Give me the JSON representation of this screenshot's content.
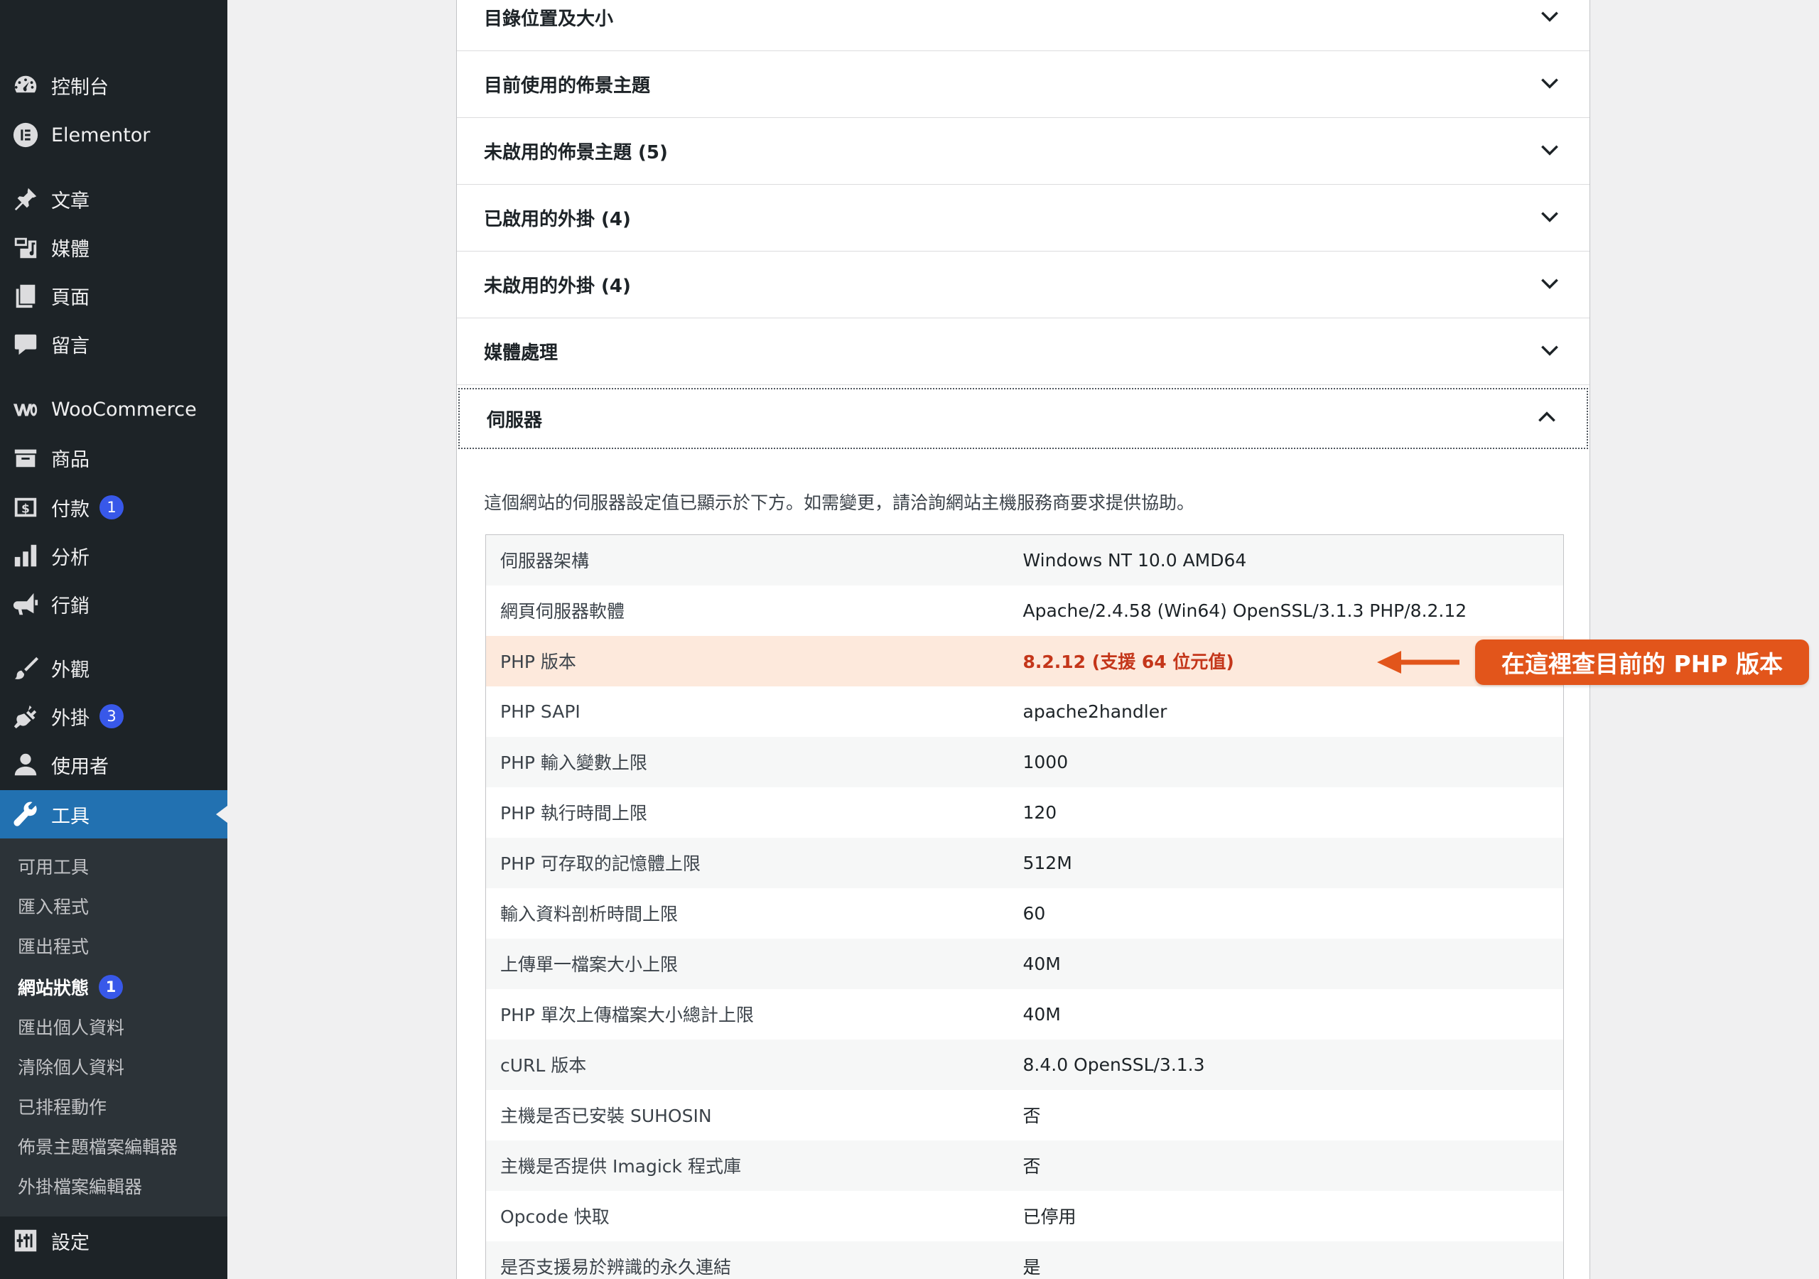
{
  "sidebar": {
    "menu": [
      {
        "key": "dashboard",
        "label": "控制台",
        "icon": "dashboard-icon"
      },
      {
        "key": "elementor",
        "label": "Elementor",
        "icon": "elementor-icon"
      },
      {
        "key": "posts",
        "label": "文章",
        "icon": "pin-icon"
      },
      {
        "key": "media",
        "label": "媒體",
        "icon": "media-icon"
      },
      {
        "key": "pages",
        "label": "頁面",
        "icon": "pages-icon"
      },
      {
        "key": "comments",
        "label": "留言",
        "icon": "comment-icon"
      },
      {
        "key": "woocommerce",
        "label": "WooCommerce",
        "icon": "woocommerce-icon"
      },
      {
        "key": "products",
        "label": "商品",
        "icon": "archive-icon"
      },
      {
        "key": "payments",
        "label": "付款",
        "icon": "dollar-icon",
        "badge": "1"
      },
      {
        "key": "analytics",
        "label": "分析",
        "icon": "bar-chart-icon"
      },
      {
        "key": "marketing",
        "label": "行銷",
        "icon": "megaphone-icon"
      },
      {
        "key": "appearance",
        "label": "外觀",
        "icon": "brush-icon"
      },
      {
        "key": "plugins",
        "label": "外掛",
        "icon": "plugin-icon",
        "badge": "3"
      },
      {
        "key": "users",
        "label": "使用者",
        "icon": "user-icon"
      },
      {
        "key": "tools",
        "label": "工具",
        "icon": "wrench-icon"
      },
      {
        "key": "settings",
        "label": "設定",
        "icon": "settings-sliders-icon"
      }
    ],
    "submenu": [
      {
        "label": "可用工具"
      },
      {
        "label": "匯入程式"
      },
      {
        "label": "匯出程式"
      },
      {
        "label": "網站狀態",
        "badge": "1"
      },
      {
        "label": "匯出個人資料"
      },
      {
        "label": "清除個人資料"
      },
      {
        "label": "已排程動作"
      },
      {
        "label": "佈景主題檔案編輯器"
      },
      {
        "label": "外掛檔案編輯器"
      }
    ]
  },
  "accordion": [
    {
      "title": "目錄位置及大小"
    },
    {
      "title": "目前使用的佈景主題"
    },
    {
      "title": "未啟用的佈景主題 (5)"
    },
    {
      "title": "已啟用的外掛 (4)"
    },
    {
      "title": "未啟用的外掛 (4)"
    },
    {
      "title": "媒體處理"
    },
    {
      "title": "伺服器"
    }
  ],
  "server": {
    "description": "這個網站的伺服器設定值已顯示於下方。如需變更，請洽詢網站主機服務商要求提供協助。",
    "rows": [
      {
        "key": "伺服器架構",
        "value": "Windows NT 10.0 AMD64"
      },
      {
        "key": "網頁伺服器軟體",
        "value": "Apache/2.4.58 (Win64) OpenSSL/3.1.3 PHP/8.2.12"
      },
      {
        "key": "PHP 版本",
        "value": "8.2.12 (支援 64 位元值)"
      },
      {
        "key": "PHP SAPI",
        "value": "apache2handler"
      },
      {
        "key": "PHP 輸入變數上限",
        "value": "1000"
      },
      {
        "key": "PHP 執行時間上限",
        "value": "120"
      },
      {
        "key": "PHP 可存取的記憶體上限",
        "value": "512M"
      },
      {
        "key": "輸入資料剖析時間上限",
        "value": "60"
      },
      {
        "key": "上傳單一檔案大小上限",
        "value": "40M"
      },
      {
        "key": "PHP 單次上傳檔案大小總計上限",
        "value": "40M"
      },
      {
        "key": "cURL 版本",
        "value": "8.4.0 OpenSSL/3.1.3"
      },
      {
        "key": "主機是否已安裝 SUHOSIN",
        "value": "否"
      },
      {
        "key": "主機是否提供 Imagick 程式庫",
        "value": "否"
      },
      {
        "key": "Opcode 快取",
        "value": "已停用"
      },
      {
        "key": "是否支援易於辨識的永久連結",
        "value": "是"
      }
    ]
  },
  "callout": {
    "text": "在這裡查目前的 PHP 版本",
    "color": "#e2551b"
  },
  "colors": {
    "sidebar_bg": "#1d2327",
    "active": "#2271b1",
    "badge": "#3858e9",
    "highlight_row": "#fde9dc"
  }
}
